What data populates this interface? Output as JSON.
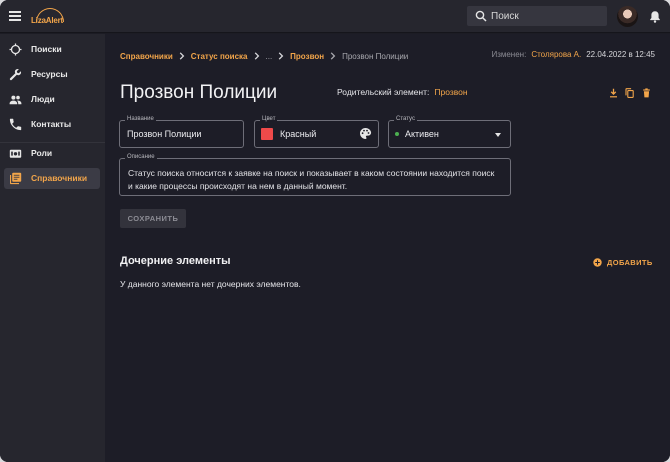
{
  "header": {
    "logo_text": "LizaAlert",
    "search_placeholder": "Поиск"
  },
  "sidebar": {
    "items": [
      {
        "label": "Поиски",
        "icon": "crosshair-icon"
      },
      {
        "label": "Ресурсы",
        "icon": "wrench-icon"
      },
      {
        "label": "Люди",
        "icon": "people-icon"
      },
      {
        "label": "Контакты",
        "icon": "phone-icon"
      },
      {
        "label": "Роли",
        "icon": "badge-icon"
      },
      {
        "label": "Справочники",
        "icon": "library-icon",
        "active": true
      }
    ]
  },
  "breadcrumb": {
    "items": [
      "Справочники",
      "Статус поиска",
      "...",
      "Прозвон"
    ],
    "current": "Прозвон Полиции"
  },
  "meta": {
    "changed_label": "Изменен:",
    "changed_by": "Столярова А.",
    "changed_at": "22.04.2022 в 12:45"
  },
  "page": {
    "title": "Прозвон Полиции",
    "parent_label": "Родительский элемент:",
    "parent_value": "Прозвон"
  },
  "form": {
    "name_label": "Название",
    "name_value": "Прозвон Полиции",
    "color_label": "Цвет",
    "color_value": "Красный",
    "color_hex": "#ef4a4a",
    "status_label": "Статус",
    "status_value": "Активен",
    "status_color": "#4caf50",
    "description_label": "Описание",
    "description_value": "Статус поиска относится к заявке на поиск и показывает в каком состоянии находится поиск и какие процессы происходят на нем в данный момент.",
    "save_label": "СОХРАНИТЬ"
  },
  "children": {
    "title": "Дочерние элементы",
    "add_label": "ДОБАВИТЬ",
    "empty_text": "У данного элемента нет дочерних элементов."
  },
  "colors": {
    "accent": "#f2a54a",
    "background": "#1d1d27",
    "sidebar": "#26262e"
  }
}
